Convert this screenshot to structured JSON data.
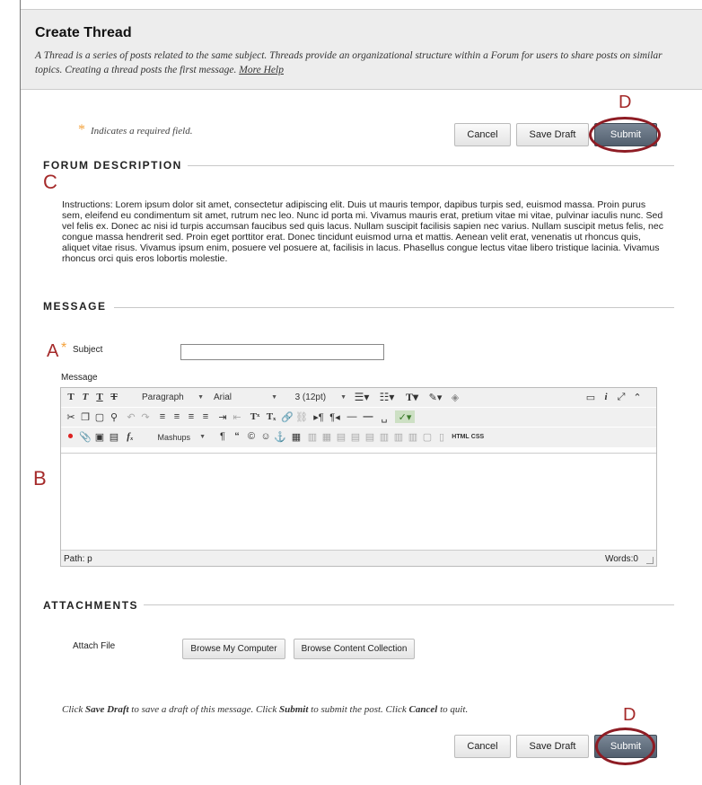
{
  "header": {
    "title": "Create Thread",
    "description": "A Thread is a series of posts related to the same subject. Threads provide an organizational structure within a Forum for users to share posts on similar topics. Creating a thread posts the first message.",
    "help_link": "More Help"
  },
  "required_note": {
    "star": "*",
    "text": "Indicates a required field."
  },
  "buttons": {
    "cancel": "Cancel",
    "save_draft": "Save Draft",
    "submit": "Submit"
  },
  "annotations": {
    "a": "A",
    "b": "B",
    "c": "C",
    "d": "D"
  },
  "forum_description": {
    "heading": "FORUM DESCRIPTION",
    "instructions": "Instructions: Lorem ipsum dolor sit amet, consectetur adipiscing elit. Duis ut mauris tempor, dapibus turpis sed, euismod massa. Proin purus sem, eleifend eu condimentum sit amet, rutrum nec leo. Nunc id porta mi. Vivamus mauris erat, pretium vitae mi vitae, pulvinar iaculis nunc. Sed vel felis ex. Donec ac nisi id turpis accumsan faucibus sed quis lacus. Nullam suscipit facilisis sapien nec varius. Nullam suscipit metus felis, nec congue massa hendrerit sed. Proin eget porttitor erat. Donec tincidunt euismod urna et mattis. Aenean velit erat, venenatis ut rhoncus quis, aliquet vitae risus. Vivamus ipsum enim, posuere vel posuere at, facilisis in lacus. Phasellus congue lectus vitae libero tristique lacinia. Vivamus rhoncus orci quis eros lobortis molestie."
  },
  "message": {
    "heading": "MESSAGE",
    "subject_label": "Subject",
    "subject_value": "",
    "message_label": "Message"
  },
  "editor": {
    "row1": {
      "paragraph": "Paragraph",
      "font": "Arial",
      "size": "3 (12pt)"
    },
    "row3": {
      "mashups": "Mashups",
      "html": "HTML",
      "css": "CSS"
    },
    "path": "Path: p",
    "words": "Words:0"
  },
  "attachments": {
    "heading": "ATTACHMENTS",
    "attach_label": "Attach File",
    "browse_computer": "Browse My Computer",
    "browse_collection": "Browse Content Collection"
  },
  "footer": {
    "p1": "Click ",
    "save_draft": "Save Draft",
    "p2": " to save a draft of this message. Click ",
    "submit": "Submit",
    "p3": " to submit the post. Click ",
    "cancel": "Cancel",
    "p4": " to quit."
  }
}
